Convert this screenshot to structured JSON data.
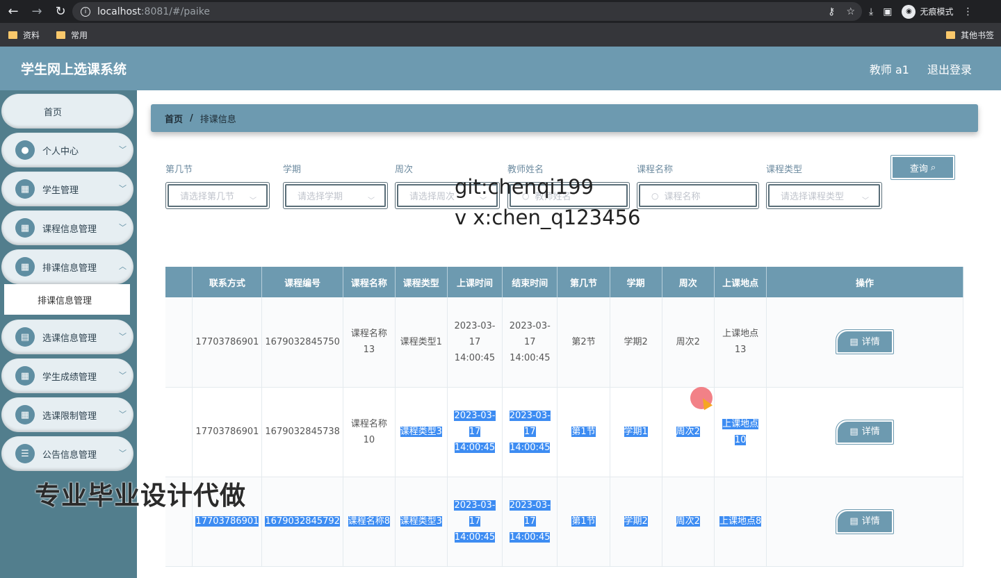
{
  "browser": {
    "url_host": "localhost",
    "url_rest": ":8081/#/paike",
    "incognito_label": "无痕模式",
    "bookmarks": [
      "资料",
      "常用"
    ],
    "other_bookmarks": "其他书签"
  },
  "header": {
    "title": "学生网上选课系统",
    "user": "教师 a1",
    "logout": "退出登录"
  },
  "sidebar": {
    "home": "首页",
    "items": [
      {
        "label": "个人中心",
        "icon": "user-icon"
      },
      {
        "label": "学生管理",
        "icon": "grid-icon"
      },
      {
        "label": "课程信息管理",
        "icon": "grid-icon"
      },
      {
        "label": "排课信息管理",
        "icon": "grid-icon"
      },
      {
        "label": "选课信息管理",
        "icon": "briefcase-icon"
      },
      {
        "label": "学生成绩管理",
        "icon": "grid-icon"
      },
      {
        "label": "选课限制管理",
        "icon": "grid-icon"
      },
      {
        "label": "公告信息管理",
        "icon": "list-icon"
      }
    ],
    "submenu_active": "排课信息管理"
  },
  "breadcrumb": {
    "home": "首页",
    "sep": "/",
    "current": "排课信息"
  },
  "filters": {
    "period_label": "第几节",
    "period_placeholder": "请选择第几节",
    "term_label": "学期",
    "term_placeholder": "请选择学期",
    "week_label": "周次",
    "week_placeholder": "请选择周次",
    "teacher_label": "教师姓名",
    "teacher_placeholder": "教师姓名",
    "course_label": "课程名称",
    "course_placeholder": "课程名称",
    "type_label": "课程类型",
    "type_placeholder": "请选择课程类型",
    "query_button": "查询"
  },
  "watermarks": {
    "line1": "git:chenqi199",
    "line2": "v x:chen_q123456",
    "side": "专业毕业设计代做"
  },
  "table": {
    "columns": [
      "",
      "联系方式",
      "课程编号",
      "课程名称",
      "课程类型",
      "上课时间",
      "结束时间",
      "第几节",
      "学期",
      "周次",
      "上课地点",
      "操作"
    ],
    "rows": [
      {
        "phone": "17703786901",
        "code": "1679032845750",
        "name": "课程名称13",
        "type": "课程类型1",
        "start": "2023-03-17 14:00:45",
        "end": "2023-03-17 14:00:45",
        "period": "第2节",
        "term": "学期2",
        "week": "周次2",
        "place": "上课地点13",
        "action": "详情"
      },
      {
        "phone": "17703786901",
        "code": "1679032845738",
        "name": "课程名称10",
        "type": "课程类型3",
        "start": "2023-03-17 14:00:45",
        "end": "2023-03-17 14:00:45",
        "period": "第1节",
        "term": "学期1",
        "week": "周次2",
        "place": "上课地点10",
        "action": "详情"
      },
      {
        "phone": "17703786901",
        "code": "1679032845792",
        "name": "课程名称8",
        "type": "课程类型3",
        "start": "2023-03-17 14:00:45",
        "end": "2023-03-17 14:00:45",
        "period": "第1节",
        "term": "学期2",
        "week": "周次2",
        "place": "上课地点8",
        "action": "详情"
      }
    ]
  }
}
